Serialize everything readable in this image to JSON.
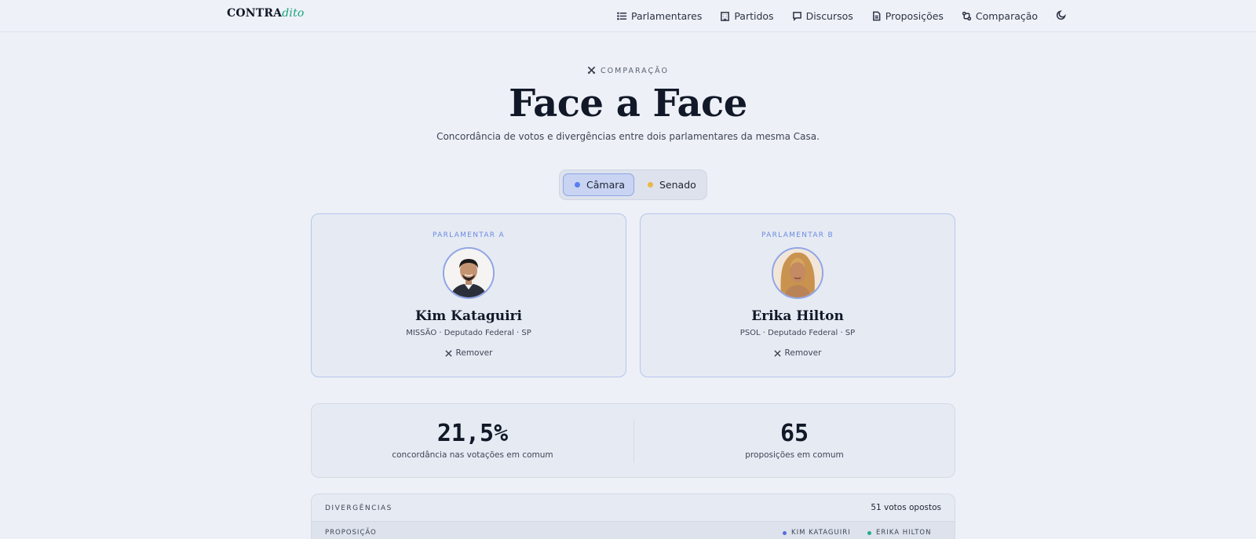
{
  "header": {
    "logo_main": "CONTRA",
    "logo_accent": "dito",
    "nav": [
      {
        "label": "Parlamentares",
        "icon": "list-icon"
      },
      {
        "label": "Partidos",
        "icon": "building-icon"
      },
      {
        "label": "Discursos",
        "icon": "speech-bubble-icon"
      },
      {
        "label": "Proposições",
        "icon": "document-icon"
      },
      {
        "label": "Comparação",
        "icon": "compare-icon"
      }
    ],
    "theme_icon": "moon-icon"
  },
  "hero": {
    "eyebrow": "COMPARAÇÃO",
    "title": "Face a Face",
    "subtitle": "Concordância de votos e divergências entre dois parlamentares da mesma Casa."
  },
  "house_toggle": {
    "options": [
      {
        "label": "Câmara",
        "dot_color": "#5b7ff0",
        "active": true
      },
      {
        "label": "Senado",
        "dot_color": "#e9b949",
        "active": false
      }
    ]
  },
  "cards": [
    {
      "slot_label": "PARLAMENTAR A",
      "name": "Kim Kataguiri",
      "meta": "MISSÃO · Deputado Federal · SP",
      "remove_label": "Remover"
    },
    {
      "slot_label": "PARLAMENTAR B",
      "name": "Erika Hilton",
      "meta": "PSOL · Deputado Federal · SP",
      "remove_label": "Remover"
    }
  ],
  "stats": {
    "agreement_value": "21,5%",
    "agreement_label": "concordância nas votações em comum",
    "common_value": "65",
    "common_label": "proposições em comum"
  },
  "divergences": {
    "title": "DIVERGÊNCIAS",
    "count": "51 votos opostos",
    "columns": {
      "proposal": "PROPOSIÇÃO",
      "a": "KIM KATAGUIRI",
      "b": "ERIKA HILTON"
    },
    "col_a_color": "#5b6bdc",
    "col_b_color": "#1fae8a"
  },
  "colors": {
    "accent": "#18a37c",
    "card_border": "#b7c6ee",
    "label_blue": "#6b8be0"
  }
}
